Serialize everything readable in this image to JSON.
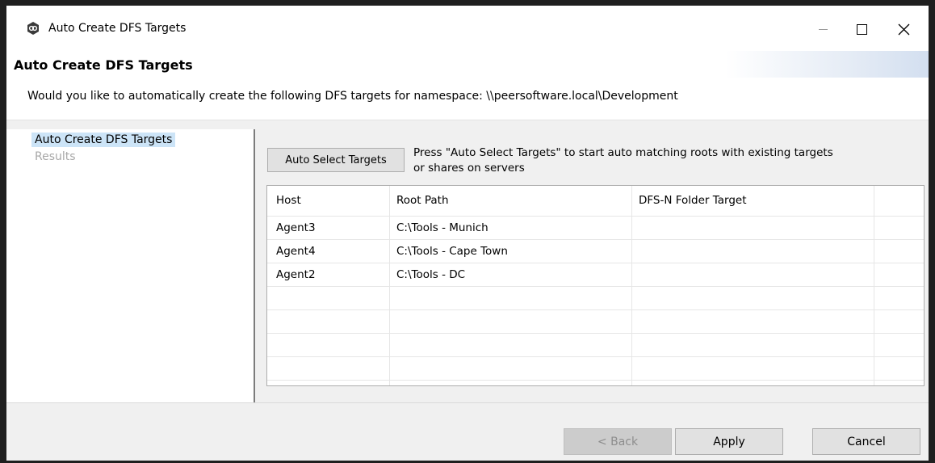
{
  "window": {
    "title": "Auto Create DFS Targets",
    "controls": {
      "minimize": "minimize-icon",
      "maximize": "maximize-icon",
      "close": "close-icon"
    }
  },
  "header": {
    "title": "Auto Create DFS Targets",
    "description": "Would you like to automatically create the following DFS targets for namespace: \\\\peersoftware.local\\Development"
  },
  "nav": {
    "items": [
      {
        "label": "Auto Create DFS Targets",
        "state": "selected"
      },
      {
        "label": "Results",
        "state": "disabled"
      }
    ]
  },
  "content": {
    "auto_select_label": "Auto Select Targets",
    "hint_line1": "Press \"Auto Select Targets\" to start auto matching roots with existing targets",
    "hint_line2": "or shares on servers",
    "table": {
      "headers": [
        "Host",
        "Root Path",
        "DFS-N Folder Target"
      ],
      "rows": [
        {
          "host": "Agent3",
          "root_path": "C:\\Tools - Munich",
          "target": ""
        },
        {
          "host": "Agent4",
          "root_path": "C:\\Tools - Cape Town",
          "target": ""
        },
        {
          "host": "Agent2",
          "root_path": "C:\\Tools - DC",
          "target": ""
        }
      ]
    }
  },
  "footer": {
    "back_label": "< Back",
    "apply_label": "Apply",
    "cancel_label": "Cancel"
  }
}
